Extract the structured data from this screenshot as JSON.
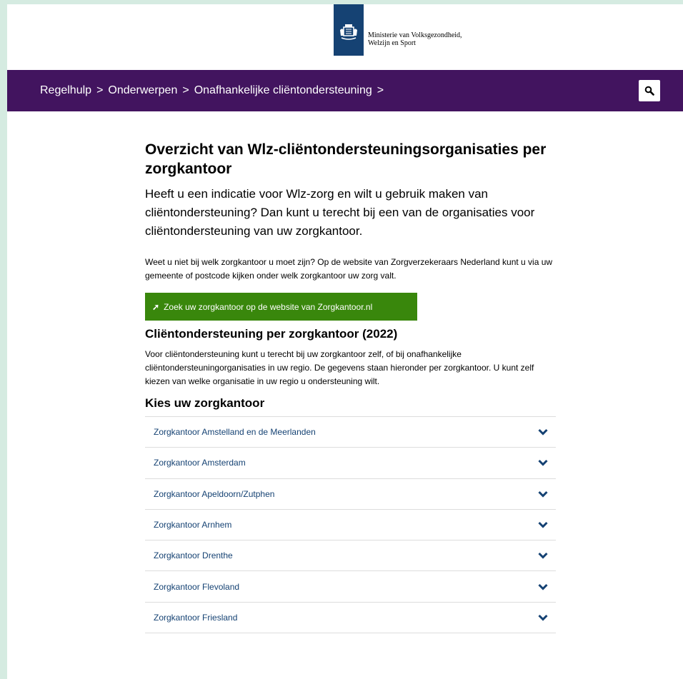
{
  "header": {
    "logo_line1": "Ministerie van Volksgezondheid,",
    "logo_line2": "Welzijn en Sport"
  },
  "breadcrumb": {
    "items": [
      "Regelhulp",
      "Onderwerpen",
      "Onafhankelijke cliëntondersteuning"
    ],
    "separator": ">"
  },
  "main": {
    "title": "Overzicht van Wlz-cliëntondersteuningsorganisaties per zorgkantoor",
    "lead": "Heeft u een indicatie voor Wlz-zorg en wilt u gebruik maken van cliëntondersteuning? Dan kunt u terecht bij een van de organisaties voor cliëntondersteuning van uw zorgkantoor.",
    "intro": "Weet u niet bij welk zorgkantoor u moet zijn? Op de website van Zorgverzekeraars Nederland kunt u via uw gemeente of postcode kijken onder welk zorgkantoor uw zorg valt.",
    "cta_label": "Zoek uw zorgkantoor op de website van Zorgkantoor.nl",
    "cta_arrow": "➚",
    "section_title": "Cliëntondersteuning per zorgkantoor (2022)",
    "section_text": "Voor cliëntondersteuning kunt u terecht bij uw zorgkantoor zelf, of bij onafhankelijke cliëntondersteuningorganisaties in uw regio. De gegevens staan hieronder per zorgkantoor. U kunt zelf kiezen van welke organisatie in uw regio u ondersteuning wilt.",
    "choose_title": "Kies uw zorgkantoor",
    "accordion": [
      "Zorgkantoor Amstelland en de Meerlanden",
      "Zorgkantoor Amsterdam",
      "Zorgkantoor Apeldoorn/Zutphen",
      "Zorgkantoor Arnhem",
      "Zorgkantoor Drenthe",
      "Zorgkantoor Flevoland",
      "Zorgkantoor Friesland"
    ]
  },
  "colors": {
    "nav_bg": "#42145f",
    "cta_bg": "#39870c",
    "link": "#154273",
    "page_border": "#d5ebe1"
  },
  "icons": [
    "logo-emblem",
    "search-icon",
    "external-arrow-icon",
    "chevron-down-icon"
  ]
}
